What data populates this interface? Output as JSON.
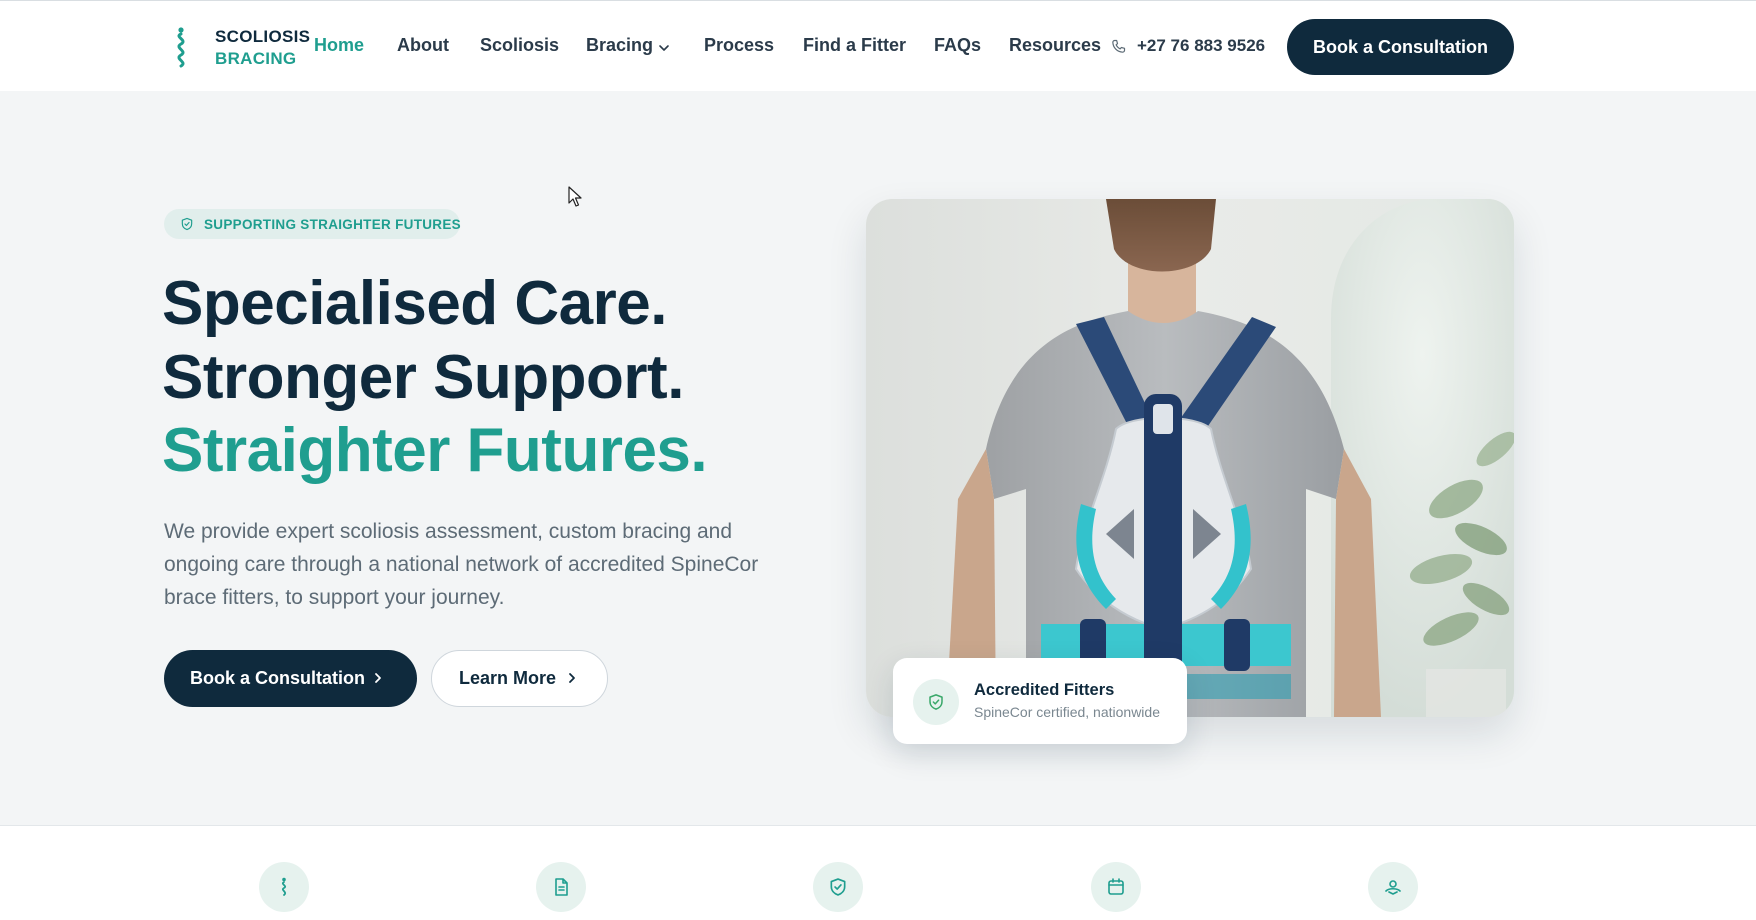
{
  "header": {
    "logo": {
      "line1": "SCOLIOSIS",
      "line2": "BRACING",
      "icon": "spine-icon"
    },
    "nav": [
      {
        "label": "Home",
        "active": true
      },
      {
        "label": "About"
      },
      {
        "label": "Scoliosis"
      },
      {
        "label": "Bracing",
        "has_dropdown": true
      },
      {
        "label": "Process"
      },
      {
        "label": "Find a Fitter"
      },
      {
        "label": "FAQs"
      },
      {
        "label": "Resources"
      }
    ],
    "phone": {
      "icon": "phone-icon",
      "number": "+27 76 883 9526"
    },
    "cta_label": "Book a Consultation"
  },
  "hero": {
    "tag": {
      "icon": "shield-check-icon",
      "text": "SUPPORTING STRAIGHTER FUTURES"
    },
    "headline": [
      "Specialised Care.",
      "Stronger Support.",
      "Straighter Futures."
    ],
    "lead": "We provide expert scoliosis assessment, custom bracing and ongoing care through a national network of accredited SpineCor brace fitters, to support your journey.",
    "primary_button": {
      "label": "Book a Consultation",
      "icon": "chevron-right-icon"
    },
    "secondary_button": {
      "label": "Learn More",
      "icon": "chevron-right-icon"
    },
    "image": {
      "subject": "woman-wearing-back-brace"
    },
    "badge": {
      "icon": "shield-check-icon",
      "title": "Accredited Fitters",
      "subtitle": "SpineCor certified, nationwide"
    }
  },
  "features": {
    "icons": [
      "spine-icon",
      "document-icon",
      "shield-check-icon",
      "calendar-icon",
      "handshake-icon"
    ]
  },
  "colors": {
    "navy": "#0f2a3d",
    "teal": "#1f9e8f",
    "background": "#f3f5f6",
    "tag_bg": "#e1eeec"
  }
}
